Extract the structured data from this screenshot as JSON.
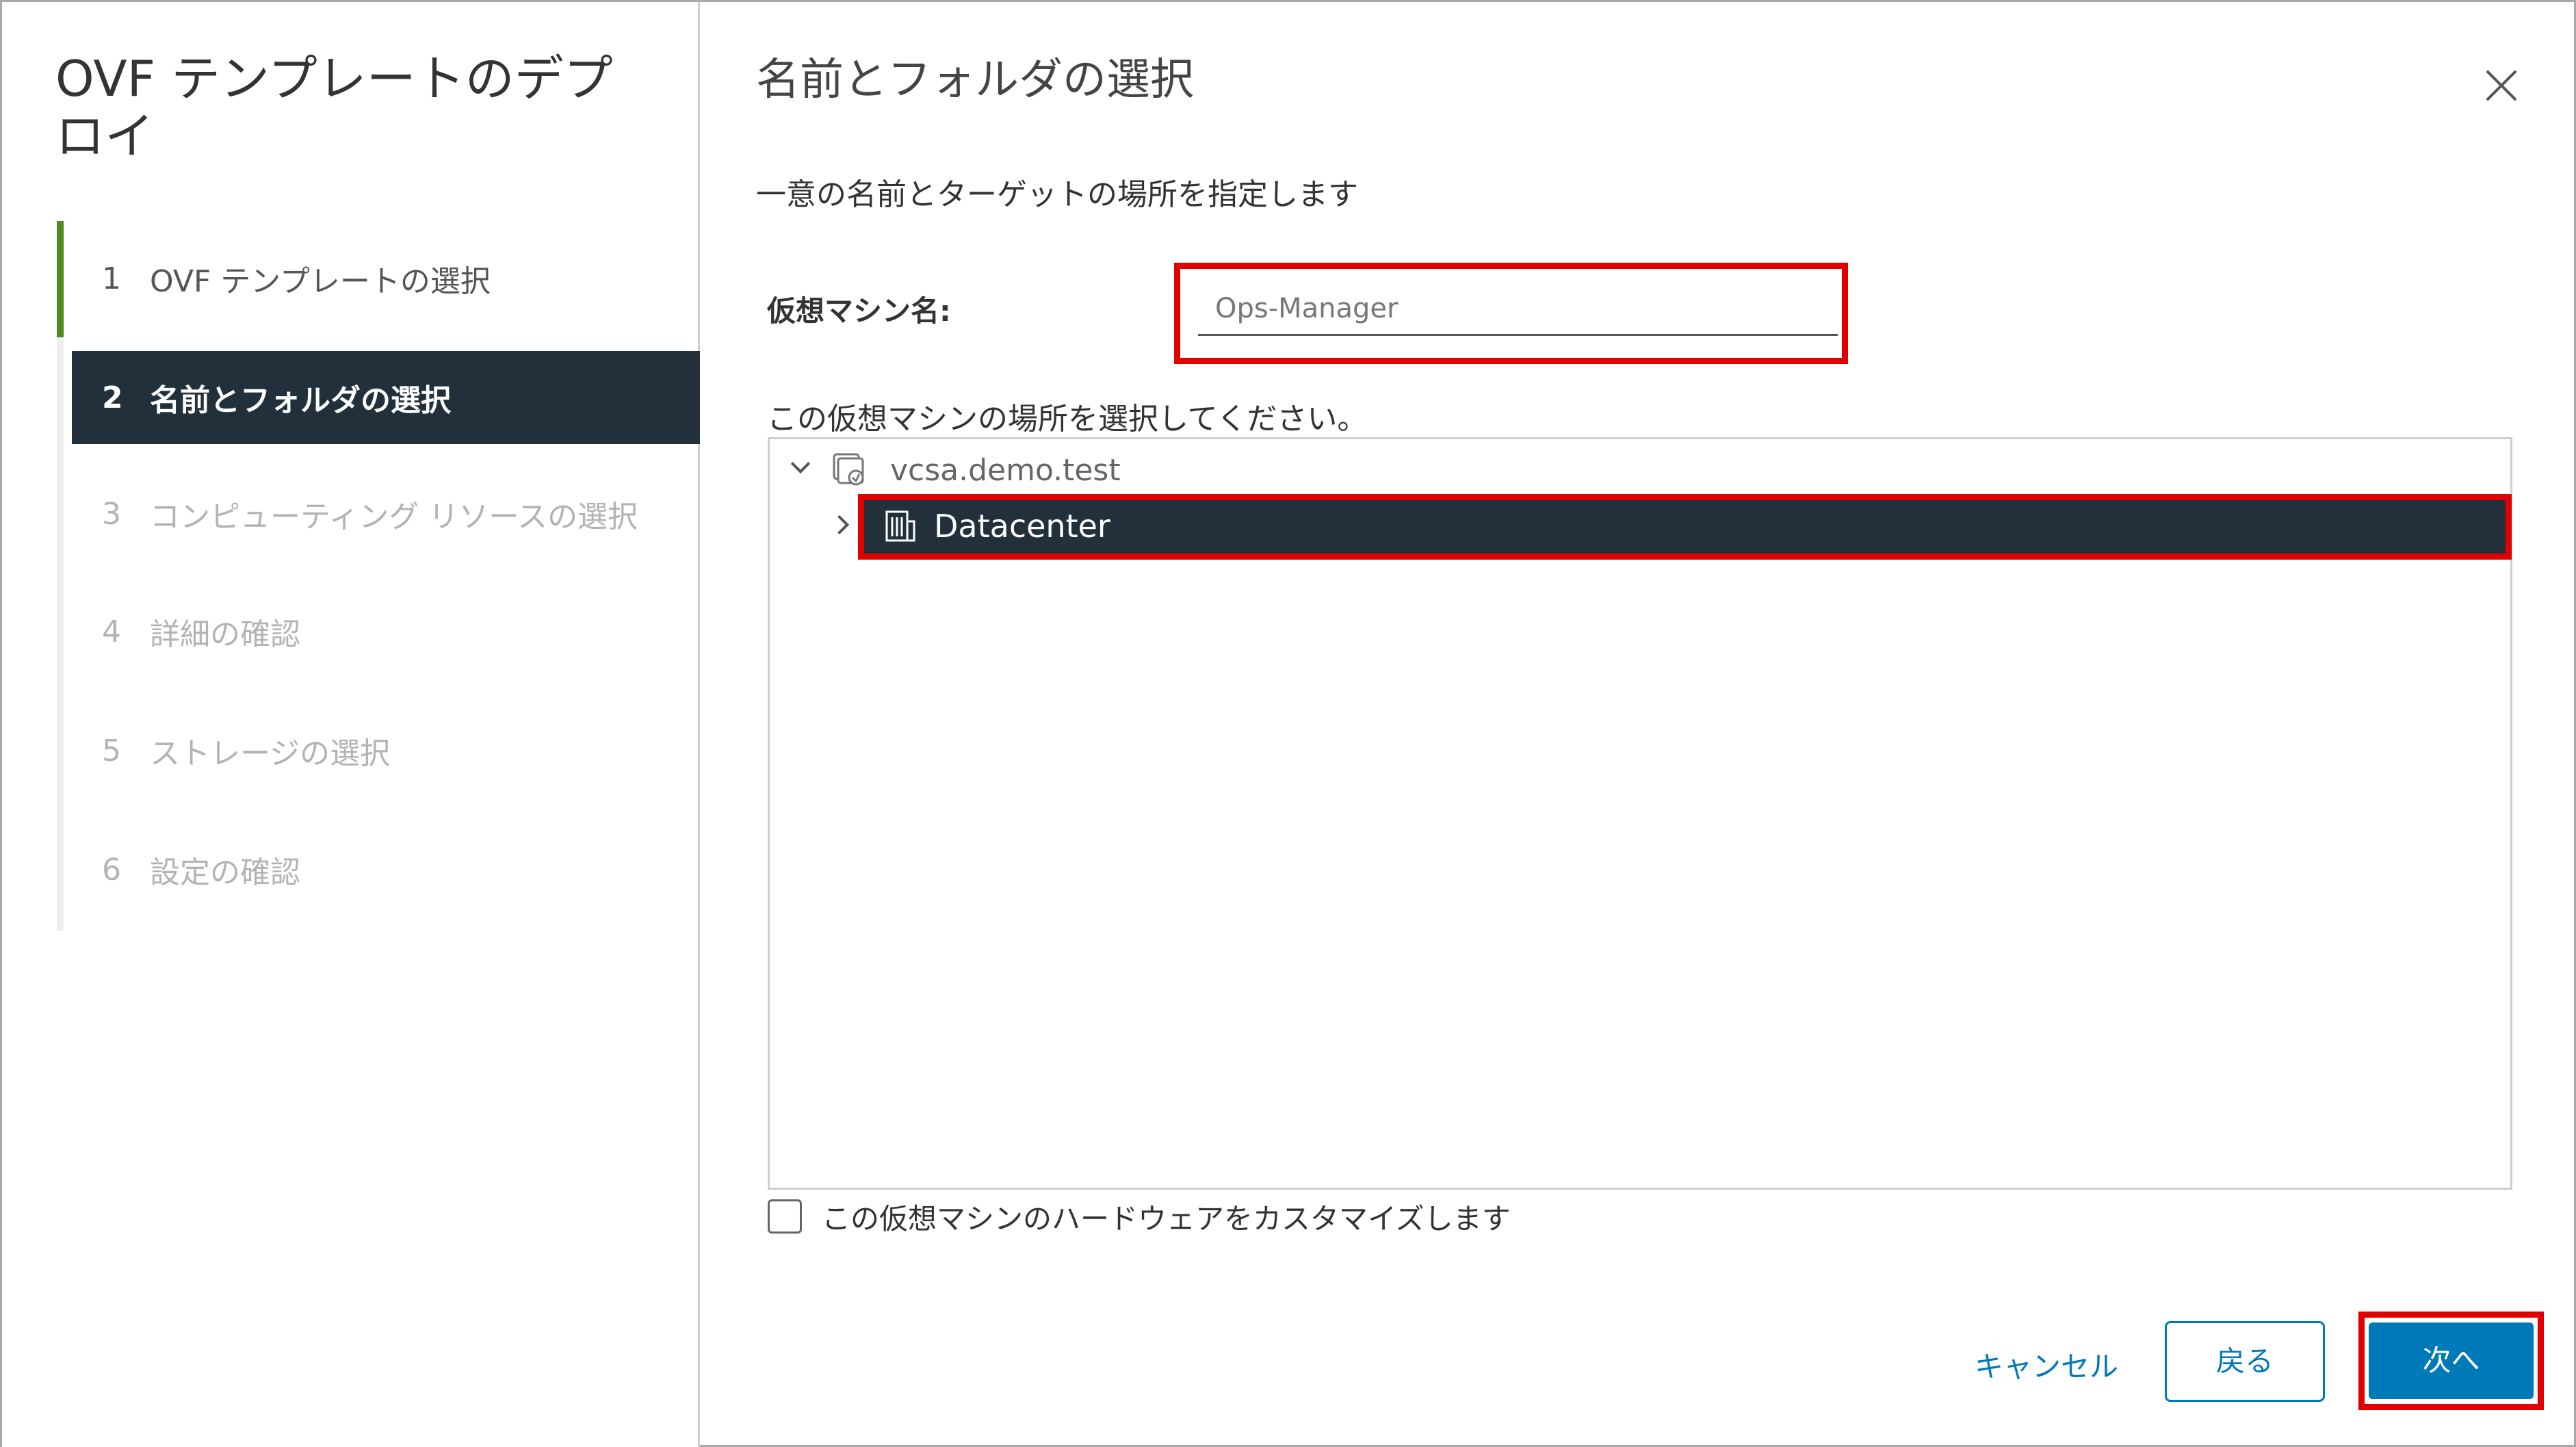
{
  "wizard": {
    "title": "OVF テンプレートのデプロイ",
    "steps": [
      {
        "num": "1",
        "label": "OVF テンプレートの選択",
        "state": "done"
      },
      {
        "num": "2",
        "label": "名前とフォルダの選択",
        "state": "active"
      },
      {
        "num": "3",
        "label": "コンピューティング リソースの選択",
        "state": "pending"
      },
      {
        "num": "4",
        "label": "詳細の確認",
        "state": "pending"
      },
      {
        "num": "5",
        "label": "ストレージの選択",
        "state": "pending"
      },
      {
        "num": "6",
        "label": "設定の確認",
        "state": "pending"
      }
    ]
  },
  "page": {
    "title": "名前とフォルダの選択",
    "subtitle": "一意の名前とターゲットの場所を指定します",
    "vm_name_label": "仮想マシン名:",
    "vm_name_value": "Ops-Manager",
    "location_label": "この仮想マシンの場所を選択してください。",
    "tree": {
      "root": {
        "label": "vcsa.demo.test",
        "icon": "vcenter-icon",
        "expanded": true
      },
      "child": {
        "label": "Datacenter",
        "icon": "datacenter-icon",
        "selected": true
      }
    },
    "customize_label": "この仮想マシンのハードウェアをカスタマイズします",
    "customize_checked": false
  },
  "buttons": {
    "cancel": "キャンセル",
    "back": "戻る",
    "next": "次へ"
  },
  "colors": {
    "accent": "#0079b8",
    "selected_bg": "#22303c",
    "highlight": "#e00000",
    "step_done": "#4f8a1f"
  }
}
